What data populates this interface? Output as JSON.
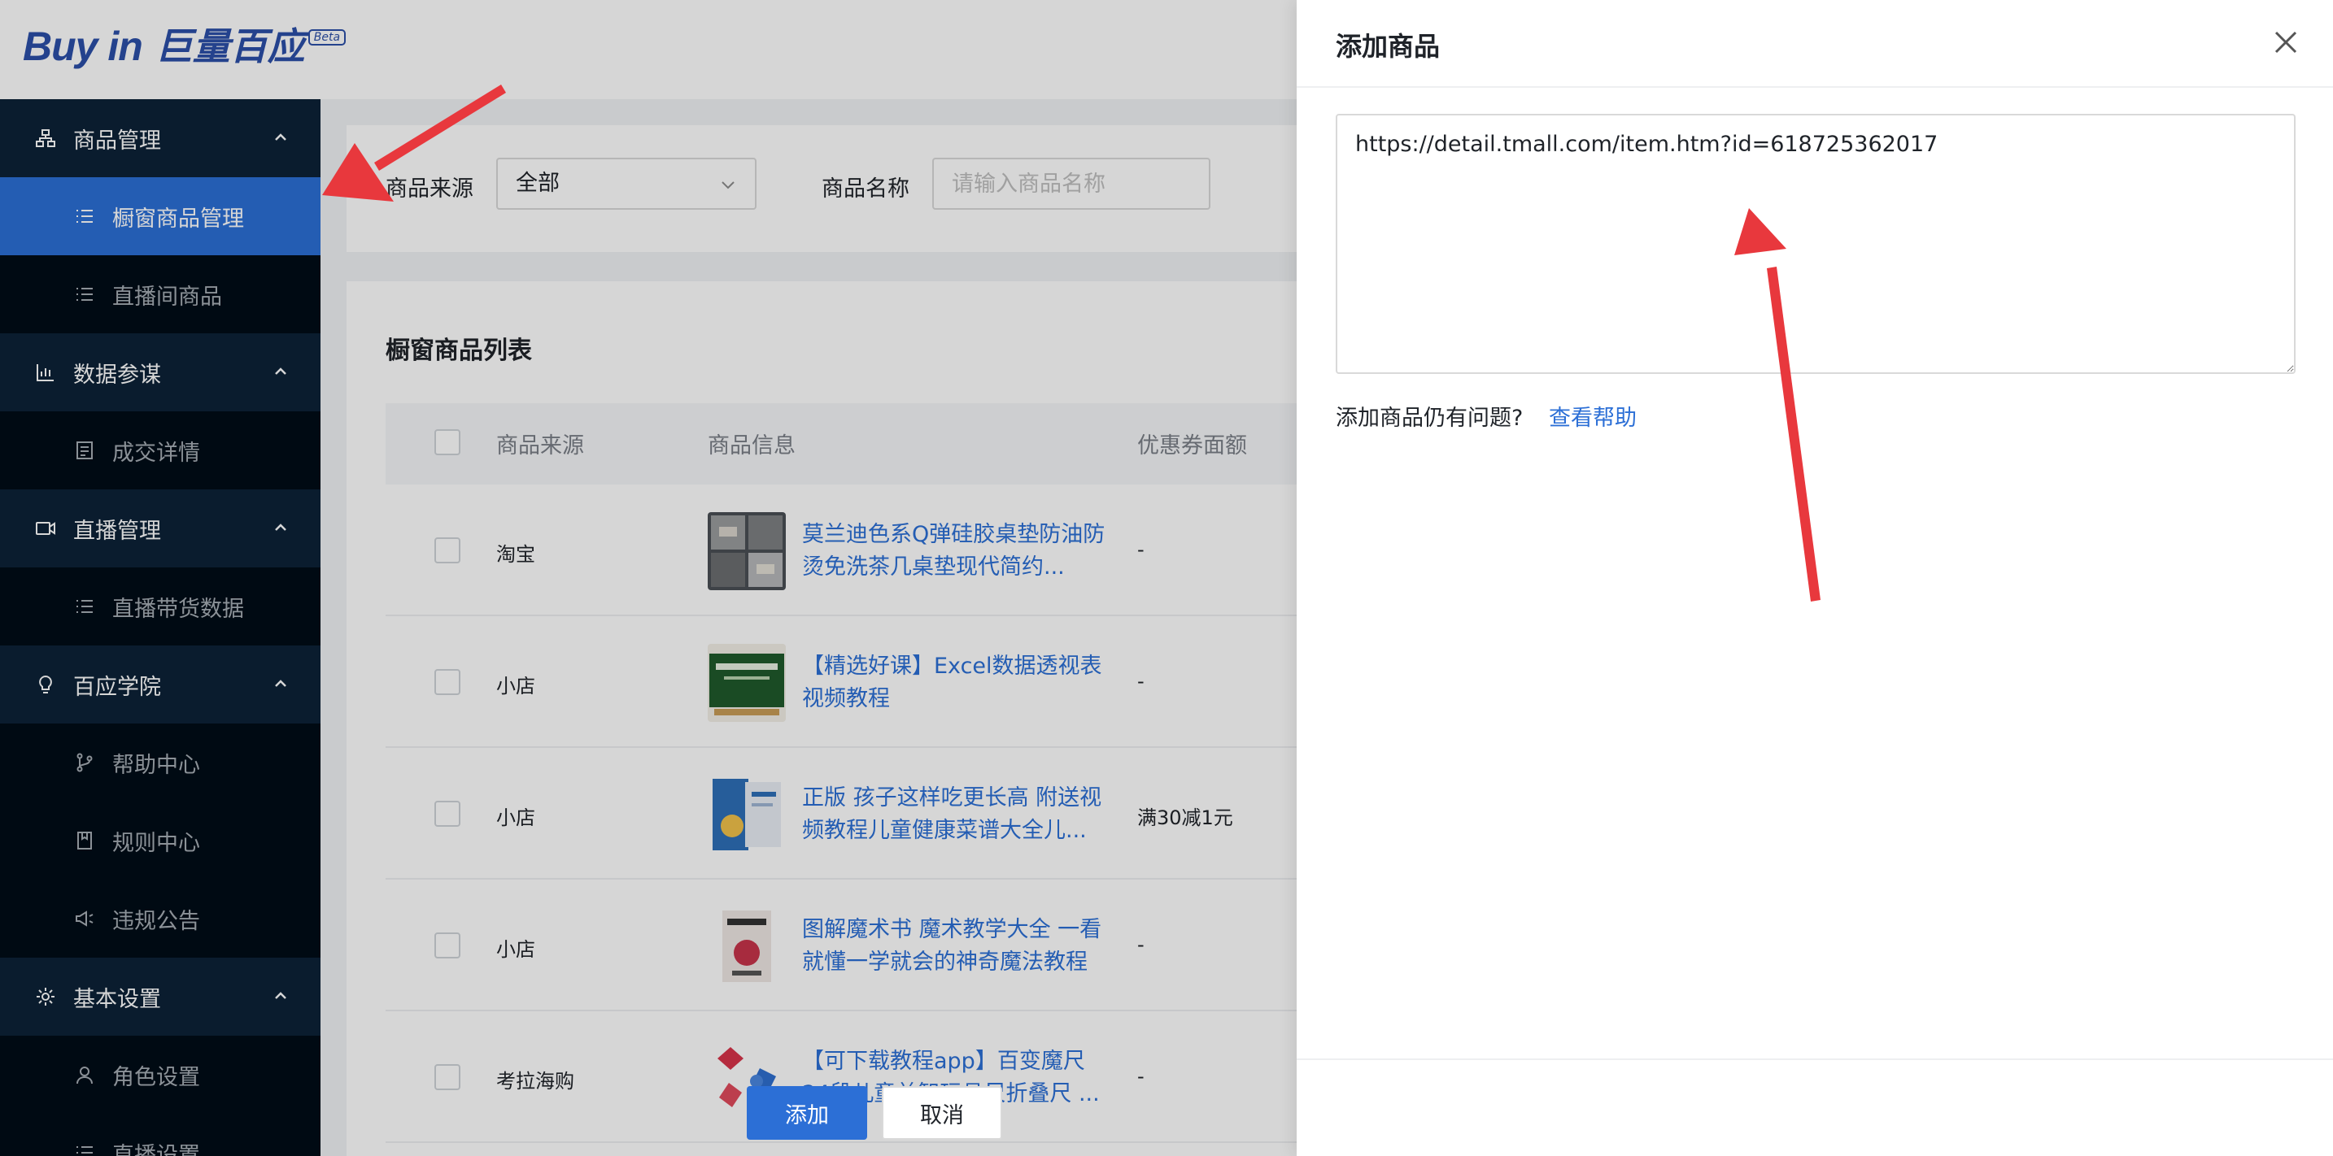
{
  "brand": {
    "logo_text": "Buy in",
    "logo_cn": "巨量百应",
    "badge": "Beta"
  },
  "sidebar": {
    "groups": [
      {
        "label": "商品管理",
        "icon": "product-tree-icon",
        "items": [
          {
            "label": "橱窗商品管理",
            "icon": "list-icon",
            "active": true
          },
          {
            "label": "直播间商品",
            "icon": "list-icon",
            "active": false
          }
        ]
      },
      {
        "label": "数据参谋",
        "icon": "bar-chart-icon",
        "items": [
          {
            "label": "成交详情",
            "icon": "document-icon",
            "active": false
          }
        ]
      },
      {
        "label": "直播管理",
        "icon": "video-camera-icon",
        "items": [
          {
            "label": "直播带货数据",
            "icon": "list-icon",
            "active": false
          }
        ]
      },
      {
        "label": "百应学院",
        "icon": "lightbulb-icon",
        "items": [
          {
            "label": "帮助中心",
            "icon": "branch-icon",
            "active": false
          },
          {
            "label": "规则中心",
            "icon": "book-icon",
            "active": false
          },
          {
            "label": "违规公告",
            "icon": "megaphone-icon",
            "active": false
          }
        ]
      },
      {
        "label": "基本设置",
        "icon": "gear-icon",
        "items": [
          {
            "label": "角色设置",
            "icon": "user-icon",
            "active": false
          },
          {
            "label": "直播设置",
            "icon": "list-icon",
            "active": false
          }
        ]
      }
    ]
  },
  "filters": {
    "source_label": "商品来源",
    "source_value": "全部",
    "name_label": "商品名称",
    "name_placeholder": "请输入商品名称"
  },
  "list": {
    "title": "橱窗商品列表",
    "columns": [
      "商品来源",
      "商品信息",
      "优惠券面额"
    ],
    "rows": [
      {
        "source": "淘宝",
        "name": "莫兰迪色系Q弹硅胶桌垫防油防烫免洗茶几桌垫现代简约...",
        "coupon": "-"
      },
      {
        "source": "小店",
        "name": "【精选好课】Excel数据透视表视频教程",
        "coupon": "-"
      },
      {
        "source": "小店",
        "name": "正版 孩子这样吃更长高 附送视频教程儿童健康菜谱大全儿...",
        "coupon": "满30减1元"
      },
      {
        "source": "小店",
        "name": "图解魔术书 魔术教学大全 一看就懂一学就会的神奇魔法教程",
        "coupon": "-"
      },
      {
        "source": "考拉海购",
        "name": "【可下载教程app】百变魔尺24段儿童益智玩具尺折叠尺 ...",
        "coupon": "-"
      }
    ]
  },
  "drawer": {
    "title": "添加商品",
    "textarea_value": "https://detail.tmall.com/item.htm?id=618725362017",
    "help_text": "添加商品仍有问题?",
    "help_link": "查看帮助",
    "add_label": "添加",
    "cancel_label": "取消"
  },
  "colors": {
    "accent": "#2c6fd6",
    "sidebar_bg": "#051627",
    "arrow": "#e8383d"
  }
}
